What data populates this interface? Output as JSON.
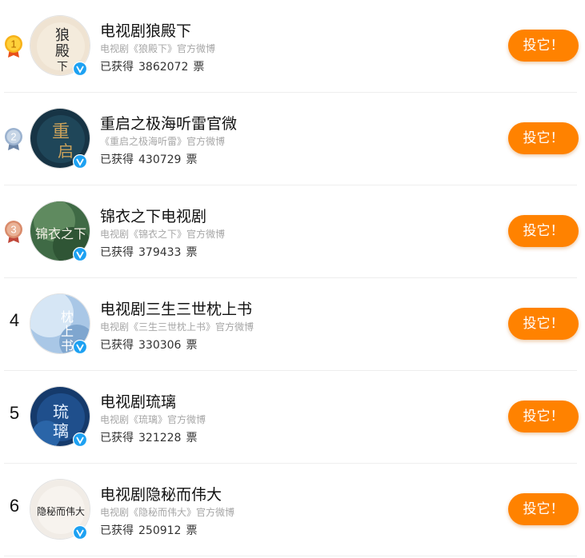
{
  "colors": {
    "accent": "#ff8200",
    "verified": "#1da1f2",
    "gold": "#f5a623",
    "silver": "#8fa6c6",
    "bronze": "#d97a57"
  },
  "items": [
    {
      "rank": "1",
      "rank_badge": "gold-medal-icon",
      "title": "电视剧狼殿下",
      "subtitle": "电视剧《狼殿下》官方微博",
      "votes_label": "已获得",
      "votes": "3862072",
      "votes_unit": "票",
      "button": "投它！",
      "avatar_text": "狼殿下"
    },
    {
      "rank": "2",
      "rank_badge": "silver-medal-icon",
      "title": "重启之极海听雷官微",
      "subtitle": "《重启之极海听雷》官方微博",
      "votes_label": "已获得",
      "votes": "430729",
      "votes_unit": "票",
      "button": "投它！",
      "avatar_text": "重启"
    },
    {
      "rank": "3",
      "rank_badge": "bronze-medal-icon",
      "title": "锦衣之下电视剧",
      "subtitle": "电视剧《锦衣之下》官方微博",
      "votes_label": "已获得",
      "votes": "379433",
      "votes_unit": "票",
      "button": "投它！",
      "avatar_text": "锦衣之下"
    },
    {
      "rank": "4",
      "title": "电视剧三生三世枕上书",
      "subtitle": "电视剧《三生三世枕上书》官方微博",
      "votes_label": "已获得",
      "votes": "330306",
      "votes_unit": "票",
      "button": "投它！",
      "avatar_text": "枕上书"
    },
    {
      "rank": "5",
      "title": "电视剧琉璃",
      "subtitle": "电视剧《琉璃》官方微博",
      "votes_label": "已获得",
      "votes": "321228",
      "votes_unit": "票",
      "button": "投它！",
      "avatar_text": "琉璃"
    },
    {
      "rank": "6",
      "title": "电视剧隐秘而伟大",
      "subtitle": "电视剧《隐秘而伟大》官方微博",
      "votes_label": "已获得",
      "votes": "250912",
      "votes_unit": "票",
      "button": "投它！",
      "avatar_text": "隐秘而伟大"
    }
  ]
}
